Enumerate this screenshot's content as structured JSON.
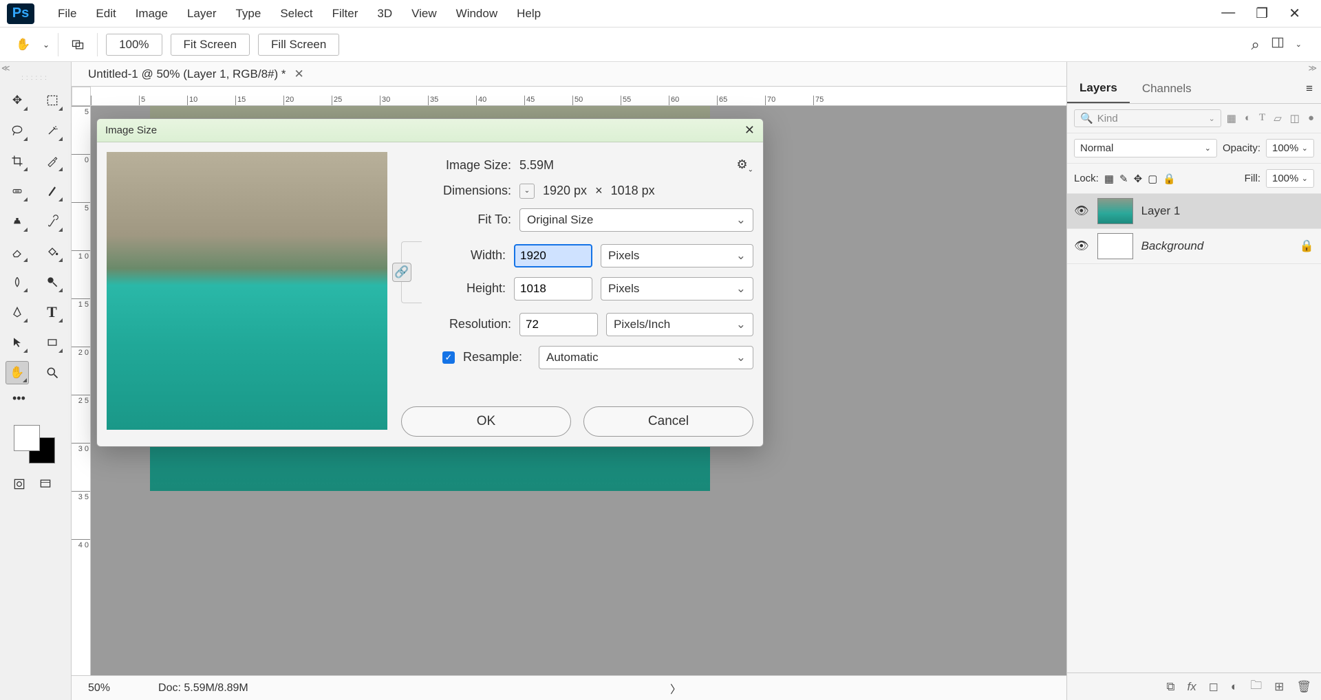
{
  "menubar": {
    "items": [
      "File",
      "Edit",
      "Image",
      "Layer",
      "Type",
      "Select",
      "Filter",
      "3D",
      "View",
      "Window",
      "Help"
    ]
  },
  "optionsbar": {
    "zoom": "100%",
    "fit_screen": "Fit Screen",
    "fill_screen": "Fill Screen"
  },
  "document": {
    "tab_title": "Untitled-1 @ 50% (Layer 1, RGB/8#) *",
    "ruler_h": [
      "",
      "5",
      "10",
      "15",
      "20",
      "25",
      "30",
      "35",
      "40",
      "45",
      "50",
      "55",
      "60",
      "65",
      "70",
      "75"
    ],
    "ruler_v": [
      "5",
      "0",
      "5",
      "1\n0",
      "1\n5",
      "2\n0",
      "2\n5",
      "3\n0",
      "3\n5",
      "4\n0"
    ],
    "status_zoom": "50%",
    "status_doc": "Doc: 5.59M/8.89M"
  },
  "dialog": {
    "title": "Image Size",
    "image_size_label": "Image Size:",
    "image_size_value": "5.59M",
    "dimensions_label": "Dimensions:",
    "dimensions_value_w": "1920 px",
    "dimensions_times": "×",
    "dimensions_value_h": "1018 px",
    "fit_to_label": "Fit To:",
    "fit_to_value": "Original Size",
    "width_label": "Width:",
    "width_value": "1920",
    "width_unit": "Pixels",
    "height_label": "Height:",
    "height_value": "1018",
    "height_unit": "Pixels",
    "resolution_label": "Resolution:",
    "resolution_value": "72",
    "resolution_unit": "Pixels/Inch",
    "resample_label": "Resample:",
    "resample_value": "Automatic",
    "ok": "OK",
    "cancel": "Cancel"
  },
  "panels": {
    "tabs": [
      "Layers",
      "Channels"
    ],
    "kind_placeholder": "Kind",
    "blend_mode": "Normal",
    "opacity_label": "Opacity:",
    "opacity_value": "100%",
    "lock_label": "Lock:",
    "fill_label": "Fill:",
    "fill_value": "100%",
    "layers": [
      {
        "name": "Layer 1",
        "locked": false
      },
      {
        "name": "Background",
        "locked": true
      }
    ]
  }
}
